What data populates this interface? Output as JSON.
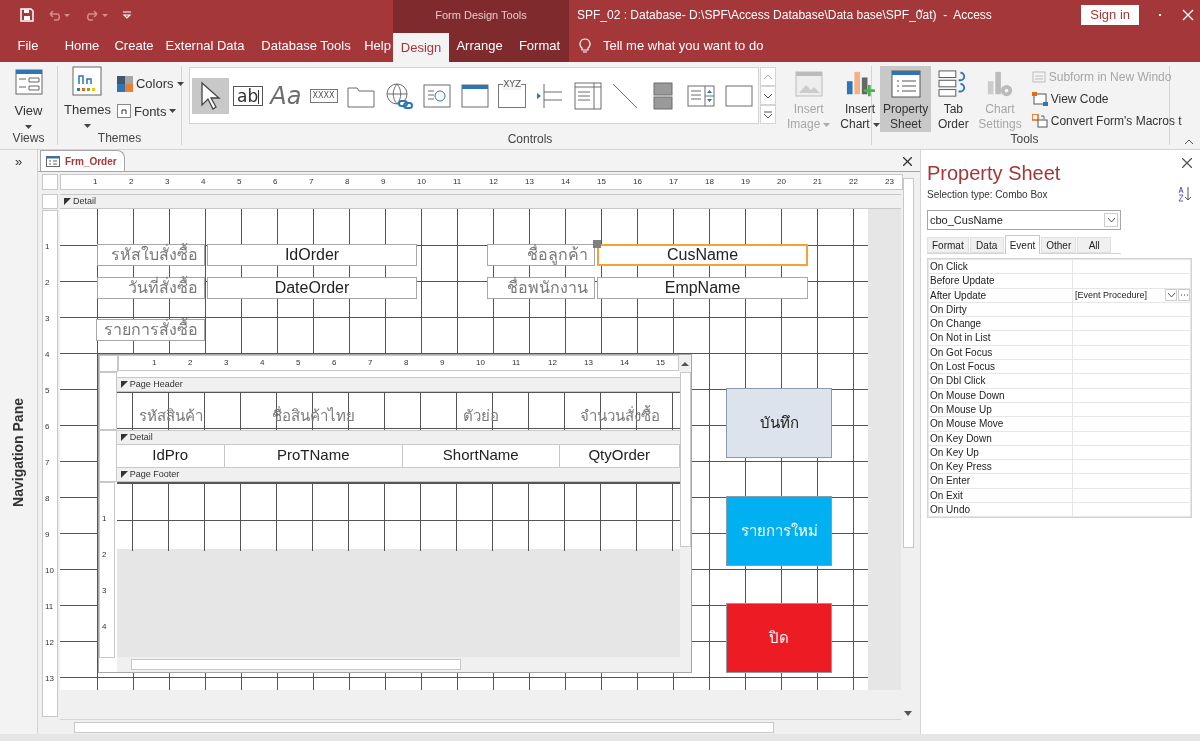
{
  "title_bar": {
    "context_label": "Form Design Tools",
    "title": "SPF_02 : Database- D:\\SPF\\Access Database\\Data base\\SPF_0ัat)  -  Access",
    "sign_in": "Sign in"
  },
  "menu_tabs": [
    {
      "label": "File",
      "selected": false,
      "contextual": false
    },
    {
      "label": "Home",
      "selected": false,
      "contextual": false
    },
    {
      "label": "Create",
      "selected": false,
      "contextual": false
    },
    {
      "label": "External Data",
      "selected": false,
      "contextual": false
    },
    {
      "label": "Database Tools",
      "selected": false,
      "contextual": false
    },
    {
      "label": "Help",
      "selected": false,
      "contextual": false
    },
    {
      "label": "Design",
      "selected": true,
      "contextual": true
    },
    {
      "label": "Arrange",
      "selected": false,
      "contextual": true
    },
    {
      "label": "Format",
      "selected": false,
      "contextual": true
    }
  ],
  "tell_me": "Tell me what you want to do",
  "ribbon": {
    "views": {
      "label": "Views",
      "view_button": "View"
    },
    "themes": {
      "label": "Themes",
      "themes_button": "Themes",
      "colors_button": "Colors",
      "fonts_button": "Fonts"
    },
    "controls": {
      "label": "Controls",
      "tools": [
        {
          "kind": "pointer",
          "selected": true
        },
        {
          "kind": "text-box",
          "glyph": "ab",
          "selected": false
        },
        {
          "kind": "label",
          "glyph": "Aa",
          "selected": false
        },
        {
          "kind": "button",
          "glyph": "XXXX",
          "selected": false
        },
        {
          "kind": "tab",
          "selected": false
        },
        {
          "kind": "hyperlink",
          "selected": false
        },
        {
          "kind": "web-browser",
          "selected": false
        },
        {
          "kind": "navigation",
          "selected": false
        },
        {
          "kind": "option-group",
          "glyph": "XYZ",
          "selected": false
        },
        {
          "kind": "page-break",
          "selected": false
        },
        {
          "kind": "combo-box",
          "selected": false
        },
        {
          "kind": "line",
          "selected": false
        },
        {
          "kind": "toggle",
          "selected": false
        },
        {
          "kind": "list-box",
          "selected": false
        },
        {
          "kind": "rectangle",
          "selected": false
        }
      ]
    },
    "tools": {
      "label": "Tools",
      "large_buttons": [
        {
          "kind": "image",
          "lines": [
            "Insert",
            "Image"
          ],
          "disabled": true,
          "selected": false,
          "dropdown": true
        },
        {
          "kind": "chart",
          "lines": [
            "Insert",
            "Chart"
          ],
          "disabled": false,
          "selected": false,
          "dropdown": true
        },
        {
          "kind": "property-sheet",
          "lines": [
            "Property",
            "Sheet"
          ],
          "disabled": false,
          "selected": true,
          "dropdown": false
        },
        {
          "kind": "tab-order",
          "lines": [
            "Tab",
            "Order"
          ],
          "disabled": false,
          "selected": false,
          "dropdown": false
        },
        {
          "kind": "chart-settings",
          "lines": [
            "Chart",
            "Settings"
          ],
          "disabled": true,
          "selected": false,
          "dropdown": false
        }
      ],
      "small_buttons": [
        {
          "kind": "subform",
          "label": "Subform in New Windo",
          "disabled": true
        },
        {
          "kind": "code",
          "label": "View Code",
          "disabled": false
        },
        {
          "kind": "macro",
          "label": "Convert Form's Macros t",
          "disabled": false
        }
      ]
    }
  },
  "navigation_pane": {
    "expand": "»",
    "label": "Navigation Pane"
  },
  "form": {
    "tab": "Frm_Order",
    "ruler_marks": [
      "1",
      "2",
      "3",
      "4",
      "5",
      "6",
      "7",
      "8",
      "9",
      "10",
      "11",
      "12",
      "13",
      "14",
      "15",
      "16",
      "17",
      "18",
      "19",
      "20",
      "21",
      "22",
      "23"
    ],
    "vertical_ruler_marks": [
      "1",
      "2",
      "3",
      "4",
      "5",
      "6",
      "7",
      "8",
      "9",
      "10",
      "11",
      "12",
      "13"
    ],
    "section": "Detail",
    "controls": [
      {
        "kind": "label",
        "text": "รหัสใบสั่งซื้อ",
        "selected": false
      },
      {
        "kind": "text-box",
        "text": "IdOrder",
        "selected": false
      },
      {
        "kind": "label",
        "text": "ชื่อลูกค้า",
        "selected": false
      },
      {
        "kind": "combo-box",
        "text": "CusName",
        "selected": true
      },
      {
        "kind": "label",
        "text": "วันที่สั่งซื้อ",
        "selected": false
      },
      {
        "kind": "text-box",
        "text": "DateOrder",
        "selected": false
      },
      {
        "kind": "label",
        "text": "ชื่อพนักงาน",
        "selected": false
      },
      {
        "kind": "text-box",
        "text": "EmpName",
        "selected": false
      },
      {
        "kind": "label",
        "text": "รายการสั่งซื้อ",
        "selected": false
      }
    ],
    "subform": {
      "ruler_marks": [
        "1",
        "2",
        "3",
        "4",
        "5",
        "6",
        "7",
        "8",
        "9",
        "10",
        "11",
        "12",
        "13",
        "14",
        "15"
      ],
      "vertical_ruler_marks": [
        "1",
        "2",
        "3",
        "4"
      ],
      "page_header": {
        "title": "Page Header",
        "labels": [
          "รหัสสินค้า",
          "ชื่อสินค้าไทย",
          "ตัวย่อ",
          "จำนวนสั่งซื้อ"
        ]
      },
      "detail": {
        "title": "Detail",
        "fields": [
          "IdPro",
          "ProTName",
          "ShortName",
          "QtyOrder"
        ]
      },
      "page_footer": {
        "title": "Page Footer"
      }
    },
    "buttons": [
      {
        "label": "บันทึก",
        "color": "#dce3ec"
      },
      {
        "label": "รายการใหม่",
        "color": "#00b0f0"
      },
      {
        "label": "ปิด",
        "color": "#ed1c24"
      }
    ]
  },
  "property_sheet": {
    "title": "Property Sheet",
    "selection_type": "Selection type:  Combo Box",
    "object": "cbo_CusName",
    "tabs": [
      {
        "label": "Format",
        "selected": false
      },
      {
        "label": "Data",
        "selected": false
      },
      {
        "label": "Event",
        "selected": true
      },
      {
        "label": "Other",
        "selected": false
      },
      {
        "label": "All",
        "selected": false
      }
    ],
    "rows": [
      {
        "name": "On Click",
        "focused": false
      },
      {
        "name": "Before Update",
        "focused": false
      },
      {
        "name": "After Update",
        "value": "[Event Procedure]",
        "focused": true
      },
      {
        "name": "On Dirty",
        "focused": false
      },
      {
        "name": "On Change",
        "focused": false
      },
      {
        "name": "On Not in List",
        "focused": false
      },
      {
        "name": "On Got Focus",
        "focused": false
      },
      {
        "name": "On Lost Focus",
        "focused": false
      },
      {
        "name": "On Dbl Click",
        "focused": false
      },
      {
        "name": "On Mouse Down",
        "focused": false
      },
      {
        "name": "On Mouse Up",
        "focused": false
      },
      {
        "name": "On Mouse Move",
        "focused": false
      },
      {
        "name": "On Key Down",
        "focused": false
      },
      {
        "name": "On Key Up",
        "focused": false
      },
      {
        "name": "On Key Press",
        "focused": false
      },
      {
        "name": "On Enter",
        "focused": false
      },
      {
        "name": "On Exit",
        "focused": false
      },
      {
        "name": "On Undo",
        "focused": false
      }
    ]
  }
}
